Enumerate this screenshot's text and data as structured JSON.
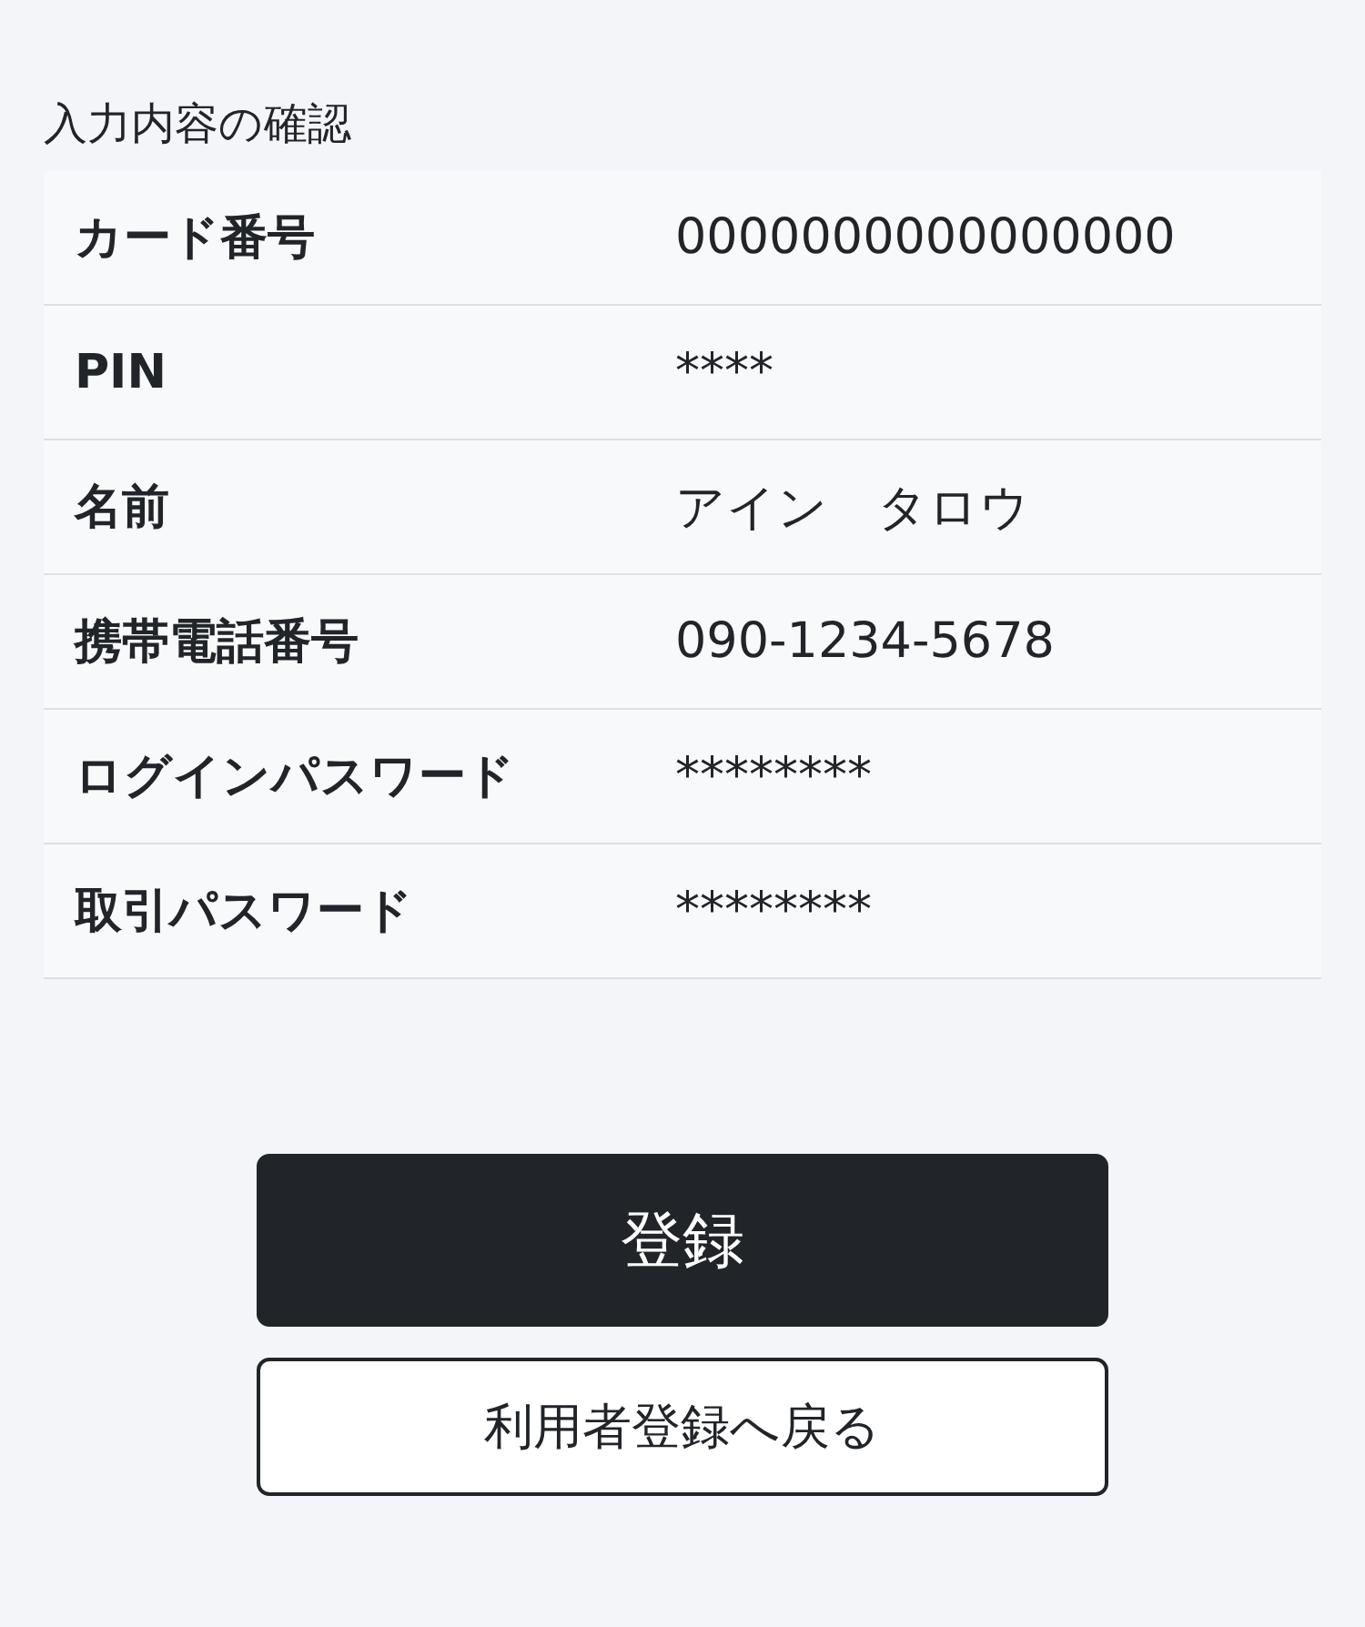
{
  "heading": "入力内容の確認",
  "rows": [
    {
      "label": "カード番号",
      "value": "0000000000000000"
    },
    {
      "label": "PIN",
      "value": "****"
    },
    {
      "label": "名前",
      "value": "アイン　タロウ"
    },
    {
      "label": "携帯電話番号",
      "value": "090-1234-5678"
    },
    {
      "label": "ログインパスワード",
      "value": "********"
    },
    {
      "label": "取引パスワード",
      "value": "********"
    }
  ],
  "buttons": [
    {
      "label": "登録",
      "kind": "primary"
    },
    {
      "label": "利用者登録へ戻る",
      "kind": "secondary"
    }
  ]
}
